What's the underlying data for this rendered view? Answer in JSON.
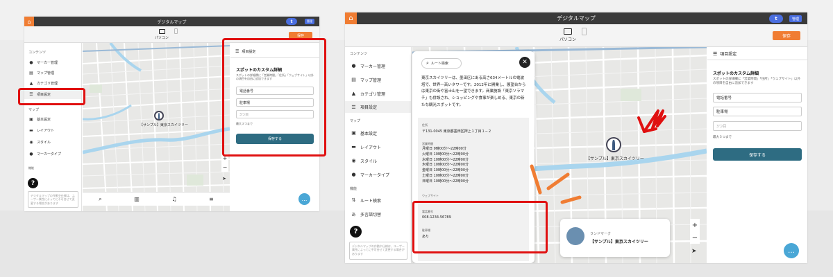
{
  "app": {
    "title": "デジタルマップ",
    "user_initial": "t",
    "header_button": "管理"
  },
  "devices": {
    "pc": "パソコン",
    "mobile": "スマートフォン"
  },
  "save_button": "保存",
  "sidebar": {
    "section_content": "コンテンツ",
    "content_items": [
      "マーカー管理",
      "マップ管理",
      "カテゴリ管理",
      "項目設定"
    ],
    "section_map": "マップ",
    "map_items": [
      "基本設定",
      "レイアウト",
      "スタイル",
      "マーカータイプ"
    ],
    "section_features": "機能",
    "feature_items": [
      "ルート検索",
      "多言語切替"
    ],
    "help_text": "デジタルマップの作動や仕様は、ユーザー属性によってに不可合せて変更する場合があります"
  },
  "panel": {
    "header": "項目設定",
    "title": "スポットのカスタム詳細",
    "desc": "スポットの詳細欄に「営業時間」「住所」「ウェブサイト」以外の項目を自由に追加できます",
    "fields": [
      "電話番号",
      "駐車場"
    ],
    "add_placeholder": "3つ目",
    "note": "最大３つまで",
    "submit": "保存する"
  },
  "map": {
    "marker_label": "【サンプル】東京スカイツリー"
  },
  "popup": {
    "route_search": "ルート検索",
    "description": "東京スカイツリーは、墨田区にある高さ634メートルの電波塔で、世界一高いタワーです。2012年に開業し、展望台からは東京の街や富士山を一望できます。商業施設「東京ソラマチ」も併設され、ショッピングや食事が楽しめる、東京の新たな観光スポットです。",
    "address_label": "住所",
    "address": "〒131-0045 東京都墨田区押上１丁目１−２",
    "hours_label": "営業時間",
    "hours": [
      "月曜日 9時00分～22時00分",
      "火曜日 10時00分～22時00分",
      "水曜日 10時00分～22時00分",
      "木曜日 10時00分～22時00分",
      "金曜日 10時00分～22時00分",
      "土曜日 10時00分～22時00分",
      "日曜日 10時00分～22時00分"
    ],
    "website_label": "ウェブサイト",
    "phone_label": "電話番号",
    "phone": "008-1234-56789",
    "parking_label": "駐車場",
    "parking": "あり"
  },
  "landmark_card": {
    "category": "ランドマーク",
    "name": "【サンプル】東京スカイツリー"
  },
  "colors": {
    "accent": "#f07d33",
    "primary": "#2e6c82",
    "highlight": "#e01010",
    "chat": "#4aa7d6"
  }
}
